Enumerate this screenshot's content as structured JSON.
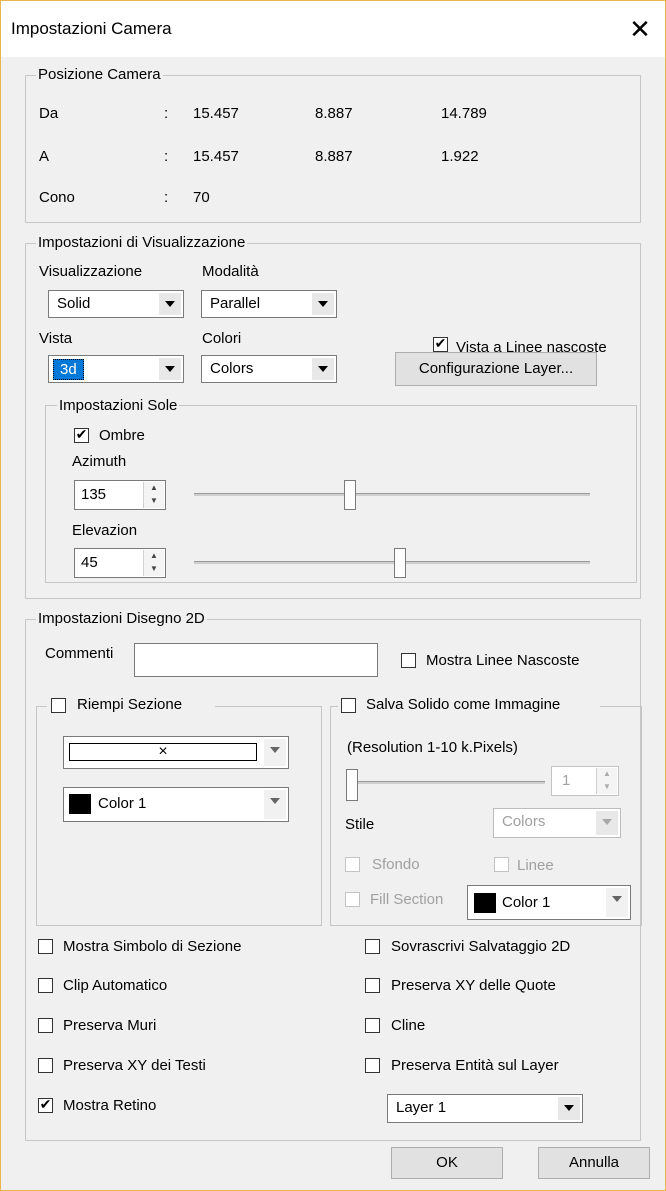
{
  "window": {
    "title": "Impostazioni Camera",
    "close_glyph": "✕"
  },
  "camera": {
    "legend": "Posizione Camera",
    "rows": [
      {
        "label": "Da",
        "sep": ":",
        "v1": "15.457",
        "v2": "8.887",
        "v3": "14.789"
      },
      {
        "label": "A",
        "sep": ":",
        "v1": "15.457",
        "v2": "8.887",
        "v3": "1.922"
      },
      {
        "label": "Cono",
        "sep": ":",
        "v1": "70"
      }
    ]
  },
  "view": {
    "legend": "Impostazioni di Visualizzazione",
    "vis_label": "Visualizzazione",
    "vis_value": "Solid",
    "mode_label": "Modalità",
    "mode_value": "Parallel",
    "vista_label": "Vista",
    "vista_value": "3d",
    "colori_label": "Colori",
    "colori_value": "Colors",
    "hidden_lines_label": "Vista a Linee nascoste",
    "hidden_lines_checked": true,
    "layer_button": "Configurazione Layer...",
    "sun": {
      "legend": "Impostazioni Sole",
      "shadow_label": "Ombre",
      "shadow_checked": true,
      "azimuth_label": "Azimuth",
      "azimuth_value": "135",
      "azimuth_slider_fraction": 0.39,
      "elevation_label": "Elevazion",
      "elevation_value": "45",
      "elevation_slider_fraction": 0.52
    }
  },
  "drawing": {
    "legend": "Impostazioni Disegno 2D",
    "comments_label": "Commenti",
    "comments_value": "",
    "show_hidden_label": "Mostra Linee Nascoste",
    "show_hidden_checked": false,
    "fill": {
      "legend": "Riempi Sezione",
      "checked": false,
      "pattern_glyph": "×",
      "color_value": "Color 1",
      "color_swatch": "#000000"
    },
    "save_solid": {
      "legend": "Salva Solido come Immagine",
      "checked": false,
      "resolution_label": "(Resolution 1-10 k.Pixels)",
      "resolution_value": "1",
      "resolution_slider_fraction": 0.0,
      "style_label": "Stile",
      "style_value": "Colors",
      "background_label": "Sfondo",
      "lines_label": "Linee",
      "fill_section_label": "Fill Section",
      "color_value": "Color 1",
      "color_swatch": "#000000"
    },
    "options_left": [
      {
        "label": "Mostra Simbolo di Sezione",
        "checked": false
      },
      {
        "label": "Clip Automatico",
        "checked": false
      },
      {
        "label": "Preserva Muri",
        "checked": false
      },
      {
        "label": "Preserva XY dei Testi",
        "checked": false
      },
      {
        "label": "Mostra Retino",
        "checked": true
      }
    ],
    "options_right": [
      {
        "label": "Sovrascrivi Salvataggio 2D",
        "checked": false
      },
      {
        "label": "Preserva XY delle Quote",
        "checked": false
      },
      {
        "label": "Cline",
        "checked": false
      },
      {
        "label": "Preserva Entità sul Layer",
        "checked": false
      }
    ],
    "layer_value": "Layer 1"
  },
  "buttons": {
    "ok": "OK",
    "cancel": "Annulla"
  },
  "check_glyph": "✔"
}
